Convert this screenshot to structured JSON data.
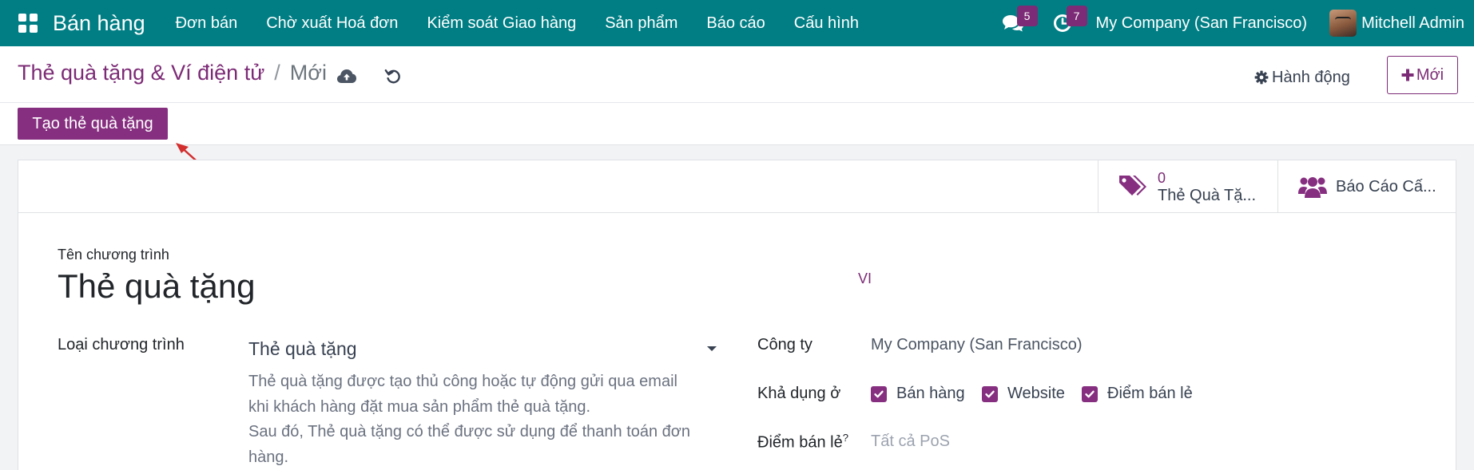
{
  "topbar": {
    "app_name": "Bán hàng",
    "menu": [
      "Đơn bán",
      "Chờ xuất Hoá đơn",
      "Kiểm soát Giao hàng",
      "Sản phẩm",
      "Báo cáo",
      "Cấu hình"
    ],
    "messages_count": "5",
    "activities_count": "7",
    "company": "My Company (San Francisco)",
    "user": "Mitchell Admin"
  },
  "control": {
    "breadcrumb_parent": "Thẻ quà tặng & Ví điện tử",
    "breadcrumb_sep": "/",
    "breadcrumb_current": "Mới",
    "action_label": "Hành động",
    "new_label": "Mới",
    "create_gift_card_label": "Tạo thẻ quà tặng"
  },
  "smart_buttons": {
    "gift_cards_count": "0",
    "gift_cards_label": "Thẻ Quà Tặ...",
    "report_label": "Báo Cáo Cấ..."
  },
  "form": {
    "program_name_label": "Tên chương trình",
    "program_name": "Thẻ quà tặng",
    "lang": "VI",
    "program_type_label": "Loại chương trình",
    "program_type": "Thẻ quà tặng",
    "help_lines": [
      "Thẻ quà tặng được tạo thủ công hoặc tự động gửi qua email",
      "khi khách hàng đặt mua sản phẩm thẻ quà tặng.",
      "Sau đó, Thẻ quà tặng có thể được sử dụng để thanh toán đơn",
      "hàng."
    ],
    "company_label": "Công ty",
    "company": "My Company (San Francisco)",
    "available_label": "Khả dụng ở",
    "available_options": [
      "Bán hàng",
      "Website",
      "Điểm bán lẻ"
    ],
    "pos_label": "Điểm bán lẻ",
    "pos_help_mark": "?",
    "pos_placeholder": "Tất cả PoS"
  },
  "colors": {
    "topbar": "#017e84",
    "accent": "#862f80",
    "badge": "#7c2b76"
  }
}
